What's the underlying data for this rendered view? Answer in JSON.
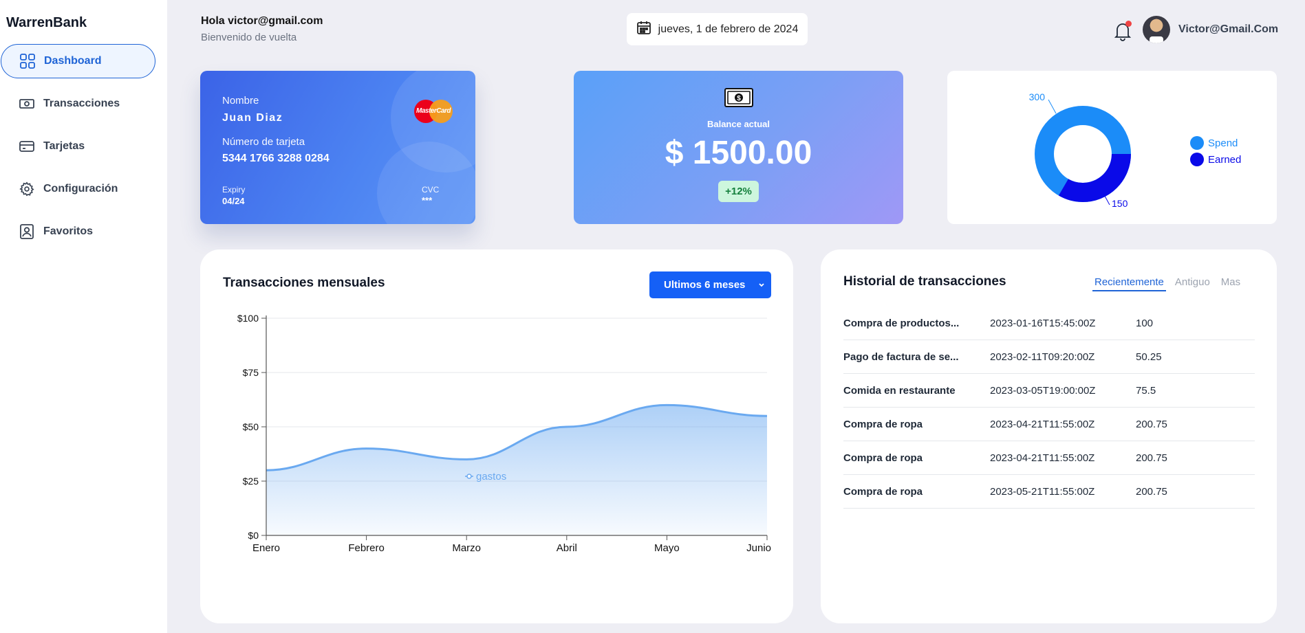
{
  "app": {
    "brand": "WarrenBank"
  },
  "sidebar": {
    "items": [
      {
        "label": "Dashboard",
        "icon": "grid-icon",
        "active": true
      },
      {
        "label": "Transacciones",
        "icon": "cash-icon",
        "active": false
      },
      {
        "label": "Tarjetas",
        "icon": "card-icon",
        "active": false
      },
      {
        "label": "Configuración",
        "icon": "gear-icon",
        "active": false
      },
      {
        "label": "Favoritos",
        "icon": "profile-icon",
        "active": false
      }
    ]
  },
  "header": {
    "greeting": "Hola victor@gmail.com",
    "subtitle": "Bienvenido de vuelta",
    "date": "jueves, 1 de febrero de 2024",
    "username": "Victor@Gmail.Com"
  },
  "card": {
    "name_label": "Nombre",
    "name": "Juan Diaz",
    "number_label": "Número de tarjeta",
    "number": "5344 1766 3288 0284",
    "expiry_label": "Expiry",
    "expiry": "04/24",
    "cvc_label": "CVC",
    "cvc": "***",
    "brand": "MasterCard"
  },
  "balance": {
    "label": "Balance actual",
    "value": "$ 1500.00",
    "change": "+12%"
  },
  "donut": {
    "labels": {
      "spend": "300",
      "earned": "150"
    },
    "legend": [
      {
        "name": "Spend",
        "color": "#1b8cf8"
      },
      {
        "name": "Earned",
        "color": "#0a0ae8"
      }
    ],
    "values": {
      "spend": 300,
      "earned": 150
    }
  },
  "monthly": {
    "title": "Transacciones mensuales",
    "range_label": "Ultimos 6 meses"
  },
  "chart_data": {
    "type": "area",
    "categories": [
      "Enero",
      "Febrero",
      "Marzo",
      "Abril",
      "Mayo",
      "Junio"
    ],
    "series": [
      {
        "name": "gastos",
        "values": [
          30,
          40,
          35,
          50,
          60,
          55
        ]
      }
    ],
    "ylim": [
      0,
      100
    ],
    "yticks": [
      "$0",
      "$25",
      "$50",
      "$75",
      "$100"
    ],
    "ytick_values": [
      0,
      25,
      50,
      75,
      100
    ],
    "grid": true,
    "legend": "bottom",
    "color": "#6aa9f0"
  },
  "history": {
    "title": "Historial de transacciones",
    "tabs": [
      "Recientemente",
      "Antiguo",
      "Mas"
    ],
    "rows": [
      {
        "desc": "Compra de productos...",
        "date": "2023-01-16T15:45:00Z",
        "amount": "100"
      },
      {
        "desc": "Pago de factura de se...",
        "date": "2023-02-11T09:20:00Z",
        "amount": "50.25"
      },
      {
        "desc": "Comida en restaurante",
        "date": "2023-03-05T19:00:00Z",
        "amount": "75.5"
      },
      {
        "desc": "Compra de ropa",
        "date": "2023-04-21T11:55:00Z",
        "amount": "200.75"
      },
      {
        "desc": "Compra de ropa",
        "date": "2023-04-21T11:55:00Z",
        "amount": "200.75"
      },
      {
        "desc": "Compra de ropa",
        "date": "2023-05-21T11:55:00Z",
        "amount": "200.75"
      }
    ]
  }
}
